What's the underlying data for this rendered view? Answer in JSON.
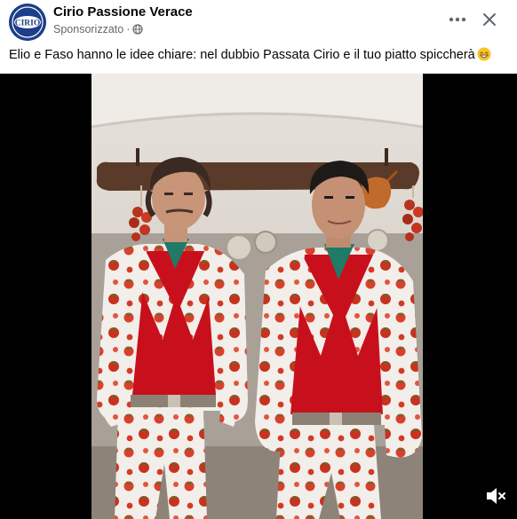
{
  "post": {
    "page_name": "Cirio Passione Verace",
    "sponsored_label": "Sponsorizzato",
    "separator": "·",
    "caption": "Elio e Faso hanno le idee chiare: nel dubbio Passata Cirio e il tuo piatto spiccherà",
    "avatar_logo_text": "CIRIO",
    "icons": {
      "privacy": "globe-icon",
      "more": "more-horizontal-icon",
      "close": "close-icon",
      "caption_emoji": "grinning-face-emoji",
      "volume": "volume-muted-icon"
    }
  },
  "colors": {
    "brand_blue": "#1d3f8a",
    "text_primary": "#050505",
    "text_secondary": "#65676b",
    "video_background": "#000000"
  }
}
